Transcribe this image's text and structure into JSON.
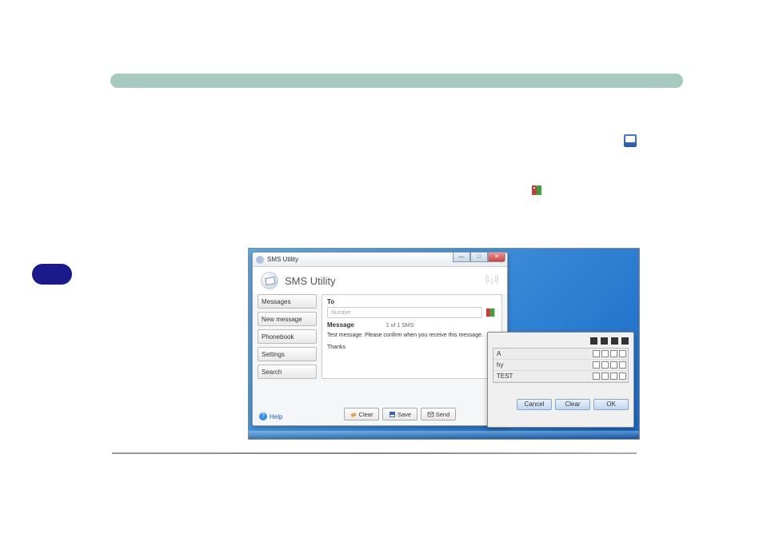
{
  "sms": {
    "window_title": "SMS Utility",
    "app_title": "SMS Utility",
    "sidebar": {
      "items": [
        {
          "label": "Messages"
        },
        {
          "label": "New message"
        },
        {
          "label": "Phonebook"
        },
        {
          "label": "Settings"
        },
        {
          "label": "Search"
        }
      ]
    },
    "form": {
      "to_label": "To",
      "to_placeholder": "Number",
      "msg_label": "Message",
      "msg_count": "1 of 1 SMS",
      "msg_text_line1": "Test message. Please confirm when you receive this message.",
      "msg_text_line2": "Thanks"
    },
    "actions": {
      "clear": "Clear",
      "save": "Save",
      "send": "Send"
    },
    "help_label": "Help"
  },
  "phonebook_popup": {
    "entries": [
      {
        "name": "A"
      },
      {
        "name": "hy"
      },
      {
        "name": "TEST"
      }
    ],
    "buttons": {
      "cancel": "Cancel",
      "clear": "Clear",
      "ok": "OK"
    }
  }
}
